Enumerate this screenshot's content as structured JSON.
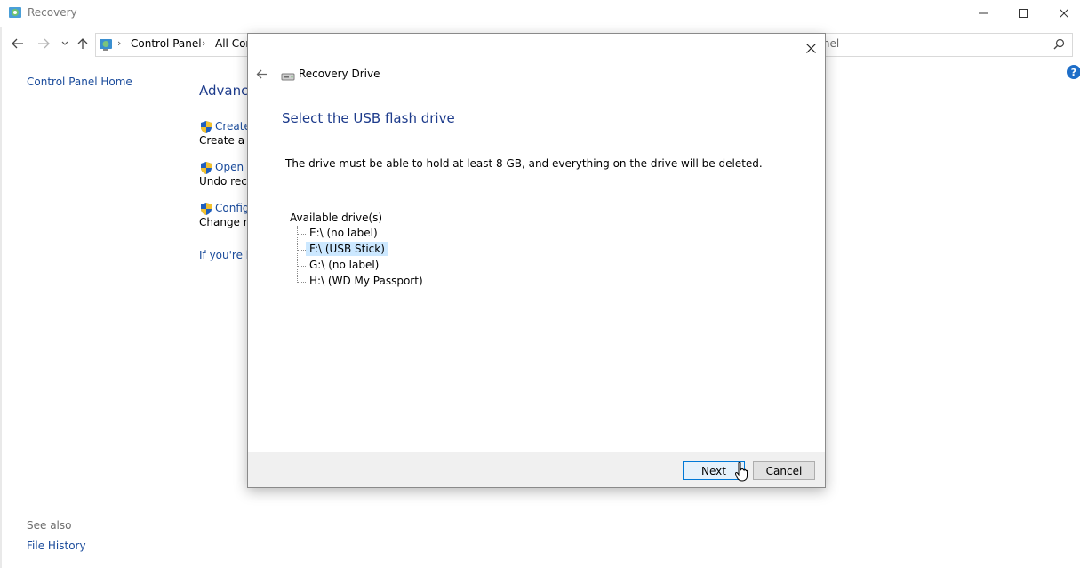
{
  "window": {
    "title": "Recovery"
  },
  "address": {
    "crumbs": [
      "Control Panel",
      "All Cor"
    ],
    "search_placeholder": "ontrol Panel"
  },
  "sidebar": {
    "home": "Control Panel Home",
    "see_also": "See also",
    "file_history": "File History"
  },
  "main": {
    "heading": "Advance",
    "options": [
      {
        "link": "Create",
        "desc": "Create a re"
      },
      {
        "link": "Open S",
        "desc": "Undo rece"
      },
      {
        "link": "Config",
        "desc": "Change re"
      }
    ],
    "footer_link": "If you're h"
  },
  "dialog": {
    "title": "Recovery Drive",
    "heading": "Select the USB flash drive",
    "instruction": "The drive must be able to hold at least 8 GB, and everything on the drive will be deleted.",
    "tree_root": "Available drive(s)",
    "drives": [
      {
        "label": "E:\\ (no label)",
        "selected": false
      },
      {
        "label": "F:\\ (USB Stick)",
        "selected": true
      },
      {
        "label": "G:\\ (no label)",
        "selected": false
      },
      {
        "label": "H:\\ (WD My Passport)",
        "selected": false
      }
    ],
    "next_label": "Next",
    "cancel_label": "Cancel"
  },
  "colors": {
    "link_blue": "#1a4b9b",
    "heading_blue": "#1e3c8c",
    "selection": "#cce8ff",
    "primary_border": "#0078d7"
  }
}
